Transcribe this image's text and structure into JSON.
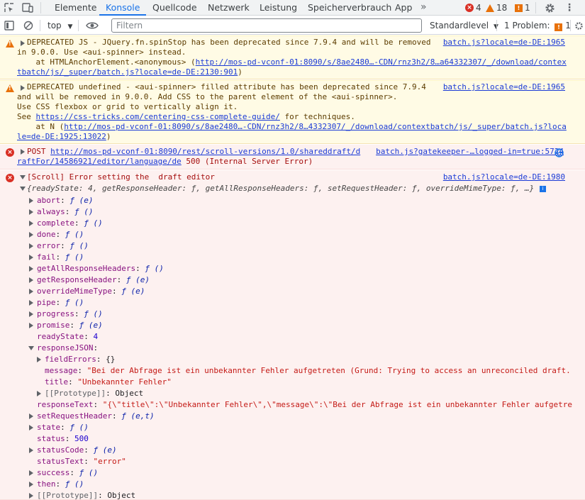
{
  "tabs": [
    "Elemente",
    "Konsole",
    "Quellcode",
    "Netzwerk",
    "Leistung",
    "Speicherverbrauch",
    "App"
  ],
  "counts": {
    "errors": "4",
    "warnings": "18",
    "issues": "1"
  },
  "toolbar": {
    "context": "top",
    "filter_placeholder": "Filtern",
    "level": "Standardlevel",
    "problems_label": "1 Problem:",
    "problems_count": "1"
  },
  "messages": {
    "m1": {
      "l1": "DEPRECATED JS - JQuery.fn.spinStop has been deprecated since 7.9.4 and will be removed",
      "l2": "in 9.0.0. Use <aui-spinner> instead.",
      "l3": "    at HTMLAnchorElement.<anonymous> (",
      "l3_link": "http://mos-pd-vconf-01:8090/s/8ae2480…-CDN/rnz3h2/8…a64332307/_/download/contex",
      "l4_link": "tbatch/js/_super/batch.js?locale=de-DE:2130:901",
      "l4_tail": ")",
      "source": "batch.js?locale=de-DE:1965"
    },
    "m2": {
      "l1": "DEPRECATED undefined - <aui-spinner> filled attribute has been deprecated since 7.9.4",
      "l2": "and will be removed in 9.0.0. Add CSS to the parent element of the <aui-spinner>.",
      "l3": "Use CSS flexbox or grid to vertically align it.",
      "l4_pre": "See ",
      "l4_link": "https://css-tricks.com/centering-css-complete-guide/",
      "l4_tail": " for techniques.",
      "l5": "    at N (",
      "l5_link": "http://mos-pd-vconf-01:8090/s/8ae2480…-CDN/rnz3h2/8…4332307/_/download/contextbatch/js/_super/batch.js?loca",
      "l6_link": "le=de-DE:1925:13022",
      "l6_tail": ")",
      "source": "batch.js?locale=de-DE:1965"
    },
    "m3": {
      "l1_pre": "POST ",
      "l1_link": "http://mos-pd-vconf-01:8090/rest/scroll-versions/1.0/shareddraft/d",
      "source": "batch.js?gatekeeper-…logged-in=true:5724",
      "l2_link": "raftFor/14586921/editor/language/de",
      "l2_tail": " 500 (Internal Server Error)"
    },
    "m4": {
      "l1": "[Scroll] Error setting the  draft editor",
      "source": "batch.js?locale=de-DE:1980",
      "summary": "{readyState: 4, getResponseHeader: ƒ, getAllResponseHeaders: ƒ, setRequestHeader: ƒ, overrideMimeType: ƒ, …}"
    }
  },
  "tree": [
    {
      "key": "abort",
      "val": "ƒ (e)"
    },
    {
      "key": "always",
      "val": "ƒ ()"
    },
    {
      "key": "complete",
      "val": "ƒ ()"
    },
    {
      "key": "done",
      "val": "ƒ ()"
    },
    {
      "key": "error",
      "val": "ƒ ()"
    },
    {
      "key": "fail",
      "val": "ƒ ()"
    },
    {
      "key": "getAllResponseHeaders",
      "val": "ƒ ()"
    },
    {
      "key": "getResponseHeader",
      "val": "ƒ (e)"
    },
    {
      "key": "overrideMimeType",
      "val": "ƒ (e)"
    },
    {
      "key": "pipe",
      "val": "ƒ ()"
    },
    {
      "key": "progress",
      "val": "ƒ ()"
    },
    {
      "key": "promise",
      "val": "ƒ (e)"
    },
    {
      "key": "readyState",
      "val": "4"
    },
    {
      "key": "responseJSON",
      "val": ""
    },
    {
      "key": "fieldErrors",
      "val": "{}"
    },
    {
      "key": "message",
      "val": "\"Bei der Abfrage ist ein unbekannter Fehler aufgetreten (Grund: Trying to access an unreconciled draft."
    },
    {
      "key": "title",
      "val": "\"Unbekannter Fehler\""
    },
    {
      "key": "[[Prototype]]",
      "val": "Object"
    },
    {
      "key": "responseText",
      "val": "\"{\\\"title\\\":\\\"Unbekannter Fehler\\\",\\\"message\\\":\\\"Bei der Abfrage ist ein unbekannter Fehler aufgetre"
    },
    {
      "key": "setRequestHeader",
      "val": "ƒ (e,t)"
    },
    {
      "key": "state",
      "val": "ƒ ()"
    },
    {
      "key": "status",
      "val": "500"
    },
    {
      "key": "statusCode",
      "val": "ƒ (e)"
    },
    {
      "key": "statusText",
      "val": "\"error\""
    },
    {
      "key": "success",
      "val": "ƒ ()"
    },
    {
      "key": "then",
      "val": "ƒ ()"
    },
    {
      "key": "[[Prototype]]",
      "val": "Object"
    }
  ]
}
